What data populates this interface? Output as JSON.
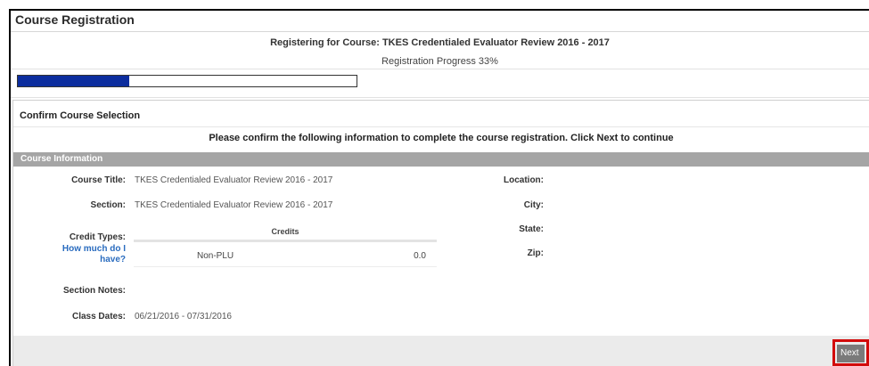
{
  "header": {
    "title": "Course Registration"
  },
  "registration": {
    "course_heading": "Registering for Course: TKES Credentialed Evaluator Review 2016 - 2017",
    "progress_label": "Registration Progress 33%",
    "progress_fraction": 0.33
  },
  "confirm": {
    "title": "Confirm Course Selection",
    "instructions": "Please confirm the following information to complete the course registration. Click Next to continue"
  },
  "course_info": {
    "section_title": "Course Information",
    "course_title_label": "Course Title:",
    "course_title_value": "TKES Credentialed Evaluator Review 2016 - 2017",
    "section_label": "Section:",
    "section_value": "TKES Credentialed Evaluator Review 2016 - 2017",
    "credit_types_label": "Credit Types:",
    "how_much_link": "How much do I have?",
    "credits_header": "Credits",
    "credits": [
      {
        "type": "Non-PLU",
        "amount": "0.0"
      }
    ],
    "section_notes_label": "Section Notes:",
    "class_dates_label": "Class Dates:",
    "class_dates_value": "06/21/2016 - 07/31/2016",
    "location_label": "Location:",
    "city_label": "City:",
    "state_label": "State:",
    "zip_label": "Zip:"
  },
  "footer": {
    "next_label": "Next"
  },
  "colors": {
    "progress_fill": "#0c2d9e",
    "info_bar": "#a5a5a5",
    "link": "#2a6cbf",
    "next_highlight": "#d20a0a"
  }
}
